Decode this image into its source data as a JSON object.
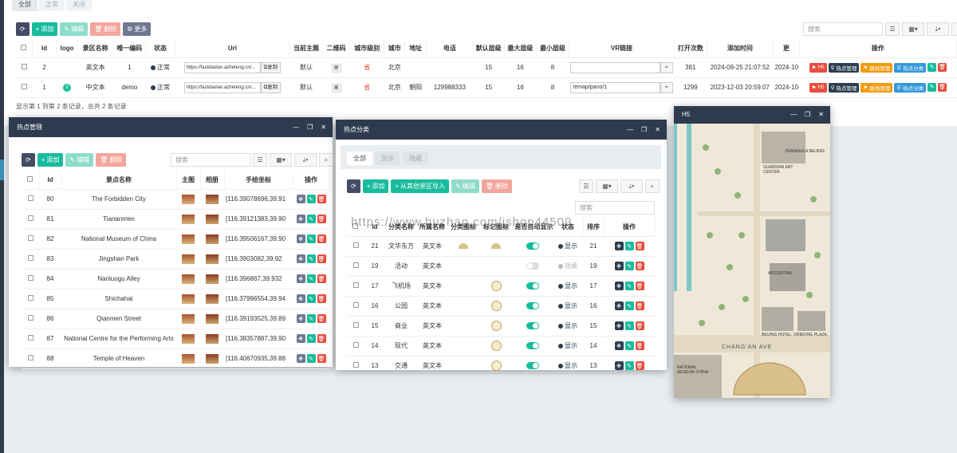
{
  "top_tabs": [
    "全部",
    "正常",
    "关闭"
  ],
  "toolbar": {
    "refresh": "",
    "add": "添加",
    "edit": "编辑",
    "delete": "删除",
    "more": "更多",
    "search_placeholder": "搜索"
  },
  "main_table": {
    "headers": [
      "Id",
      "logo",
      "景区名称",
      "唯一编码",
      "状态",
      "Url",
      "当前主题",
      "二维码",
      "城市级别",
      "城市",
      "地址",
      "电话",
      "默认层级",
      "最大层级",
      "最小层级",
      "VR链接",
      "打开次数",
      "添加时间",
      "更",
      "操作"
    ],
    "rows": [
      {
        "id": "2",
        "name": "英文本",
        "code": "1",
        "status": "正常",
        "url": "https://fastdaolan.azheteng.cn/...",
        "copy": "复制",
        "theme": "默认",
        "city_level": "省",
        "city": "北京",
        "address": "",
        "phone": "",
        "default_level": "15",
        "max_level": "16",
        "min_level": "8",
        "vr": "",
        "opens": "381",
        "added": "2024-09-25 21:07:52",
        "updated": "2024-10-"
      },
      {
        "id": "1",
        "name": "中文本",
        "code": "demo",
        "status": "正常",
        "url": "https://fastdaolan.azheteng.cn/...",
        "copy": "复制",
        "theme": "默认",
        "city_level": "省",
        "city": "北京",
        "address": "朝阳",
        "phone": "129988333",
        "default_level": "15",
        "max_level": "16",
        "min_level": "8",
        "vr": "/emap/pano/1",
        "opens": "1299",
        "added": "2023-12-03 20:59:07",
        "updated": "2024-10-"
      }
    ],
    "op_buttons": [
      "H5",
      "热点管理",
      "路线管理",
      "热点分类"
    ],
    "footer": "显示第 1 到第 2 条记录，总共 2 条记录"
  },
  "hotspot_window": {
    "title": "热点管理",
    "search_placeholder": "搜索",
    "headers": [
      "Id",
      "景点名称",
      "主图",
      "相册",
      "手绘坐标",
      "操作"
    ],
    "rows": [
      {
        "id": "80",
        "name": "The Forbidden City",
        "coord": "[116.39078696,39.91"
      },
      {
        "id": "81",
        "name": "Tiananmen",
        "coord": "[116.39121383,39.90"
      },
      {
        "id": "82",
        "name": "National Museum of China",
        "coord": "[116.39506167,39.90"
      },
      {
        "id": "83",
        "name": "Jingshan Park",
        "coord": "[116.3903082,39.92"
      },
      {
        "id": "84",
        "name": "Nanluogu Alley",
        "coord": "[116.396867,39.932"
      },
      {
        "id": "85",
        "name": "Shichahai",
        "coord": "[116.37996554,39.94"
      },
      {
        "id": "86",
        "name": "Qianmen Street",
        "coord": "[116.39193525,39.89"
      },
      {
        "id": "87",
        "name": "National Centre for the Performing Arts",
        "coord": "[116.38357887,39.90"
      },
      {
        "id": "88",
        "name": "Temple of Heaven",
        "coord": "[116.40670935,39.88"
      }
    ]
  },
  "category_window": {
    "title": "热点分类",
    "tabs": [
      "全部",
      "显示",
      "隐藏"
    ],
    "import_label": "从其他景区导入",
    "search_placeholder": "搜索",
    "headers": [
      "Id",
      "分类名称",
      "所属名称",
      "分类图标",
      "标记图标",
      "是否自动显示",
      "状态",
      "排序",
      "操作"
    ],
    "rows": [
      {
        "id": "21",
        "name": "文华东方",
        "lang": "英文本",
        "icon": "fan",
        "marker": "fan",
        "auto": true,
        "status": "显示",
        "sort": "21"
      },
      {
        "id": "19",
        "name": "活动",
        "lang": "英文本",
        "icon": "",
        "marker": "",
        "auto": false,
        "status": "隐藏",
        "sort": "19"
      },
      {
        "id": "17",
        "name": "飞机场",
        "lang": "英文本",
        "icon": "",
        "marker": "pin",
        "auto": true,
        "status": "显示",
        "sort": "17"
      },
      {
        "id": "16",
        "name": "公园",
        "lang": "英文本",
        "icon": "",
        "marker": "pin",
        "auto": true,
        "status": "显示",
        "sort": "16"
      },
      {
        "id": "15",
        "name": "商业",
        "lang": "英文本",
        "icon": "",
        "marker": "pin",
        "auto": true,
        "status": "显示",
        "sort": "15"
      },
      {
        "id": "14",
        "name": "现代",
        "lang": "英文本",
        "icon": "",
        "marker": "pin",
        "auto": true,
        "status": "显示",
        "sort": "14"
      },
      {
        "id": "13",
        "name": "交通",
        "lang": "英文本",
        "icon": "",
        "marker": "pin",
        "auto": true,
        "status": "显示",
        "sort": "13"
      }
    ]
  },
  "h5_window": {
    "title": "H5",
    "map_labels": [
      "GUARDIAN ART CENTER",
      "PENINSULA BEIJING",
      "WFCENTRAL",
      "BEIJING HOTEL",
      "ORIENTAL PLAZA",
      "CHANG'AN AVE",
      "NATIONAL MUSEUM CHINA"
    ]
  },
  "watermark": "https://www.huzhan.com/ishop44509"
}
